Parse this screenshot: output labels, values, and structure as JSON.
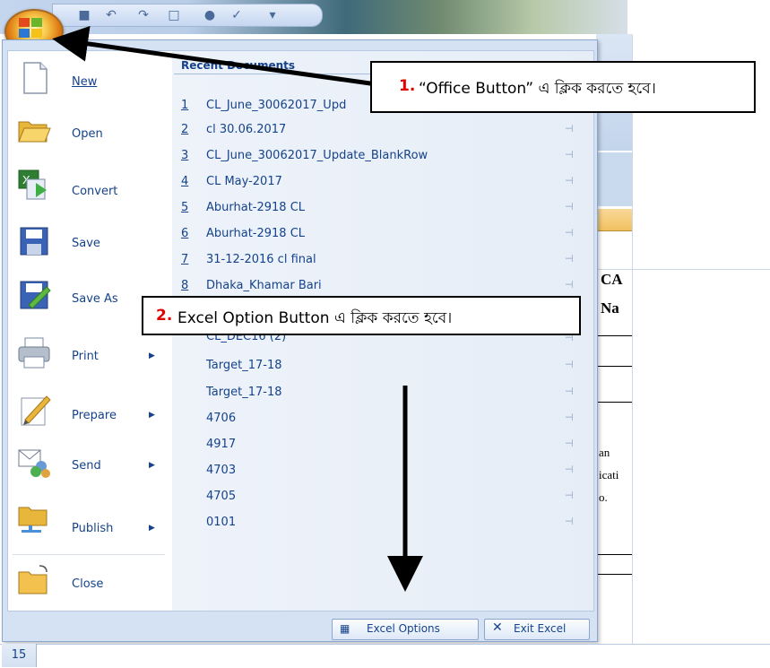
{
  "quick_access": {
    "icons": [
      "save-icon",
      "undo-icon",
      "redo-icon",
      "print-preview-icon",
      "circle-icon",
      "check-icon",
      "customize-icon"
    ]
  },
  "recent": {
    "header": "Recent Documents",
    "items": [
      {
        "num": "1",
        "name": "CL_June_30062017_Upd"
      },
      {
        "num": "2",
        "name": "cl 30.06.2017"
      },
      {
        "num": "3",
        "name": "CL_June_30062017_Update_BlankRow"
      },
      {
        "num": "4",
        "name": "CL May-2017"
      },
      {
        "num": "5",
        "name": "Aburhat-2918 CL"
      },
      {
        "num": "6",
        "name": "Aburhat-2918 CL"
      },
      {
        "num": "7",
        "name": "31-12-2016 cl final"
      },
      {
        "num": "8",
        "name": "Dhaka_Khamar Bari"
      },
      {
        "num": "",
        "name": "CL_DEC16 (2)"
      },
      {
        "num": "",
        "name": "Target_17-18"
      },
      {
        "num": "",
        "name": "Target_17-18"
      },
      {
        "num": "",
        "name": "4706"
      },
      {
        "num": "",
        "name": "4917"
      },
      {
        "num": "",
        "name": "4703"
      },
      {
        "num": "",
        "name": "4705"
      },
      {
        "num": "",
        "name": "0101"
      }
    ]
  },
  "menu": {
    "items": [
      {
        "label": "New",
        "icon": "new-document-icon",
        "arrow": ""
      },
      {
        "label": "Open",
        "icon": "open-folder-icon",
        "arrow": ""
      },
      {
        "label": "Convert",
        "icon": "convert-icon",
        "arrow": ""
      },
      {
        "label": "Save",
        "icon": "save-icon",
        "arrow": ""
      },
      {
        "label": "Save As",
        "icon": "save-as-icon",
        "arrow": ""
      },
      {
        "label": "Print",
        "icon": "printer-icon",
        "arrow": "▶"
      },
      {
        "label": "Prepare",
        "icon": "prepare-icon",
        "arrow": "▶"
      },
      {
        "label": "Send",
        "icon": "send-icon",
        "arrow": "▶"
      },
      {
        "label": "Publish",
        "icon": "publish-icon",
        "arrow": "▶"
      },
      {
        "label": "Close",
        "icon": "close-folder-icon",
        "arrow": ""
      }
    ]
  },
  "buttons": {
    "excel_options": "Excel Options",
    "exit_excel": "Exit Excel"
  },
  "callouts": {
    "one": {
      "num": "1.",
      "text": "“Office Button” এ ক্লিক করতে হবে।"
    },
    "two": {
      "num": "2.",
      "text": "Excel Option Button এ ক্লিক করতে হবে।"
    }
  },
  "sheet": {
    "fragments": [
      "CA",
      "Na",
      "an",
      "icati",
      "o."
    ],
    "row_number": "15",
    "title_letter": "w"
  },
  "colors": {
    "callout_number": "#e00000",
    "menu_text": "#15428b",
    "arrow": "#000000"
  }
}
